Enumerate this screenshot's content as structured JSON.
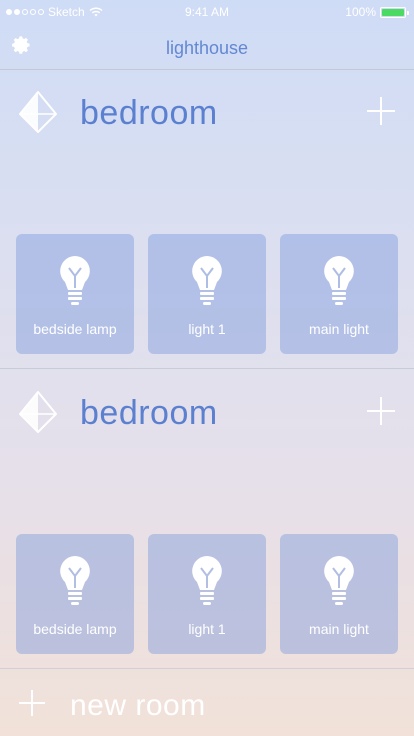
{
  "status_bar": {
    "carrier": "Sketch",
    "time": "9:41 AM",
    "battery": "100%",
    "battery_level": 1.0
  },
  "nav": {
    "title": "lighthouse",
    "settings_icon": "gear-icon"
  },
  "rooms": [
    {
      "name": "bedroom",
      "icon": "diamond-icon",
      "add_icon": "plus-icon",
      "devices": [
        {
          "label": "bedside lamp",
          "icon": "lightbulb-icon"
        },
        {
          "label": "light 1",
          "icon": "lightbulb-icon"
        },
        {
          "label": "main light",
          "icon": "lightbulb-icon"
        }
      ]
    },
    {
      "name": "bedroom",
      "icon": "diamond-icon",
      "add_icon": "plus-icon",
      "devices": [
        {
          "label": "bedside lamp",
          "icon": "lightbulb-icon"
        },
        {
          "label": "light 1",
          "icon": "lightbulb-icon"
        },
        {
          "label": "main light",
          "icon": "lightbulb-icon"
        }
      ]
    }
  ],
  "new_room": {
    "label": "new room",
    "icon": "plus-icon"
  },
  "colors": {
    "accent": "#5b80cf",
    "tile": "#a9b9e4",
    "battery_fill": "#4cd964"
  }
}
